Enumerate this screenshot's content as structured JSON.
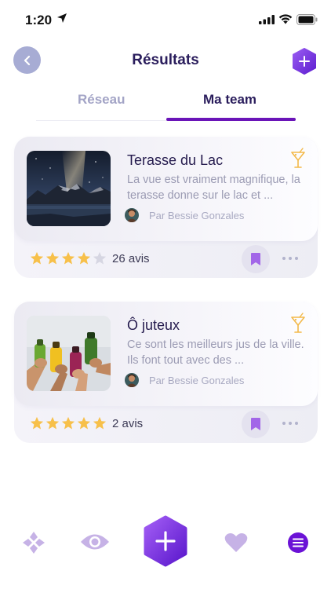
{
  "status_bar": {
    "time": "1:20"
  },
  "header": {
    "title": "Résultats"
  },
  "tabs": [
    {
      "label": "Réseau",
      "active": false
    },
    {
      "label": "Ma team",
      "active": true
    }
  ],
  "results": [
    {
      "title": "Terasse du Lac",
      "description": "La vue est vraiment magnifique, la terasse donne sur le lac et ...",
      "author": "Par Bessie Gonzales",
      "rating": 4,
      "rating_max": 5,
      "reviews": "26 avis",
      "icon": "drink-icon",
      "image": "night-lake-mountains"
    },
    {
      "title": "Ô juteux",
      "description": "Ce sont les meilleurs jus de la ville. Ils font tout avec des ...",
      "author": "Par Bessie Gonzales",
      "rating": 5,
      "rating_max": 5,
      "reviews": "2 avis",
      "icon": "drink-icon",
      "image": "juice-bottles"
    }
  ],
  "bottom_nav": [
    "flower-icon",
    "eye-icon",
    "add-icon",
    "heart-icon",
    "menu-icon"
  ],
  "colors": {
    "accent": "#7b2ee6",
    "accent_dark": "#4b0fa8",
    "star": "#f7c04a",
    "star_empty": "#d6d6e2",
    "nav_light": "#c6b2e6"
  }
}
